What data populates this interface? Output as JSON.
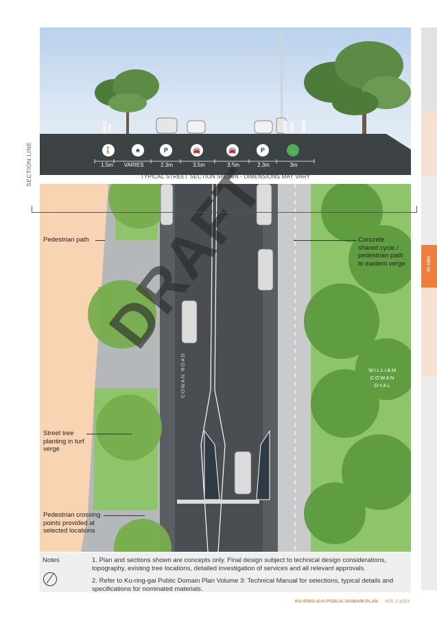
{
  "side_tab": {
    "label": "ST IVES",
    "color": "#ef7d3c"
  },
  "section": {
    "caption": "TYPICAL STREET SECTION SHOWN - DIMENSIONS MAY VARY",
    "icons": [
      {
        "name": "pedestrian-icon",
        "glyph": "🚶"
      },
      {
        "name": "tree-icon",
        "glyph": "♣"
      },
      {
        "name": "parking-icon",
        "glyph": "P"
      },
      {
        "name": "car-icon",
        "glyph": "🚘"
      },
      {
        "name": "car-icon",
        "glyph": "🚘"
      },
      {
        "name": "parking-icon",
        "glyph": "P"
      },
      {
        "name": "cycle-pedestrian-icon",
        "glyph": "🚲"
      }
    ],
    "dimensions": [
      "1.5m",
      "VARIES",
      "2.3m",
      "3.5m",
      "3.5m",
      "2.3m",
      "3m"
    ]
  },
  "section_line_label": "SECTION LINE",
  "plan": {
    "labels": {
      "pedestrian_path": "Pedestrian path",
      "concrete_path": [
        "Concrete",
        "shared cycle /",
        "pedestrian path",
        "to eastern verge"
      ],
      "street_tree": [
        "Street tree",
        "planting in turf",
        "verge"
      ],
      "crossing": [
        "Pedestrian crossing",
        "points provided at",
        "selected locations"
      ]
    },
    "road_name": "COWAN ROAD",
    "oval_name": [
      "WILLIAM",
      "COWAN",
      "OVAL"
    ],
    "watermark": "DRAFT"
  },
  "notes": {
    "title": "Notes",
    "items": [
      "1.  Plan and sections shown are concepts only. Final design subject to technical design considerations, topography, existing tree locations, detailed investigation of services and all relevant approvals.",
      "2.  Refer to Ku-ring-gai Public Domain Plan Volume 3: Technical Manual for selections, typical details and specifications for nominated materials."
    ]
  },
  "footer": {
    "title": "KU-RING-GAI PUBLIC DOMAIN PLAN",
    "page": "VOL 2 p251"
  }
}
